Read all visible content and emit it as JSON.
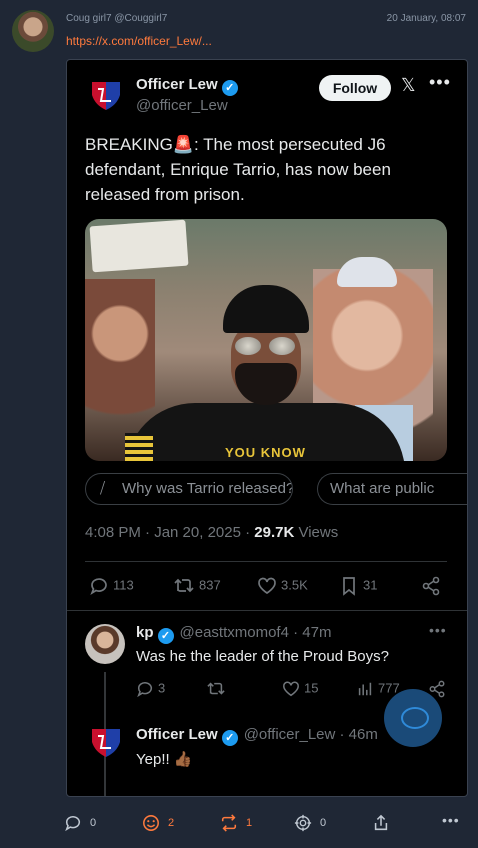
{
  "post": {
    "author": "Coug girl7",
    "handle": "@Couggirl7",
    "date": "20 January, 08:07",
    "link": "https://x.com/officer_Lew/..."
  },
  "tweet": {
    "name": "Officer Lew",
    "handle": "@officer_Lew",
    "follow_label": "Follow",
    "text": "BREAKING🚨: The most persecuted J6 defendant, Enrique Tarrio, has now been released from prison.",
    "image_shirt_text": "YOU KNOW",
    "grok_chips": [
      "Why was Tarrio released?",
      "What are public"
    ],
    "time": "4:08 PM · Jan 20, 2025 · ",
    "views_count": "29.7K",
    "views_label": " Views",
    "replies": "113",
    "retweets": "837",
    "likes": "3.5K",
    "bookmarks": "31"
  },
  "replies": [
    {
      "name": "kp",
      "handle": "@easttxmomof4 · 47m",
      "text": "Was he the leader of the Proud Boys?",
      "replies": "3",
      "retweets": "",
      "likes": "15",
      "views": "777"
    },
    {
      "name": "Officer Lew",
      "handle": "@officer_Lew · 46m",
      "text": "Yep!! 👍🏾"
    }
  ],
  "bottom_bar": {
    "comments": "0",
    "reactions": "2",
    "reposts": "1",
    "boosts": "0"
  },
  "colors": {
    "accent": "#ff7a3d",
    "verified": "#1d9bf0",
    "page_bg": "#1f2735"
  }
}
